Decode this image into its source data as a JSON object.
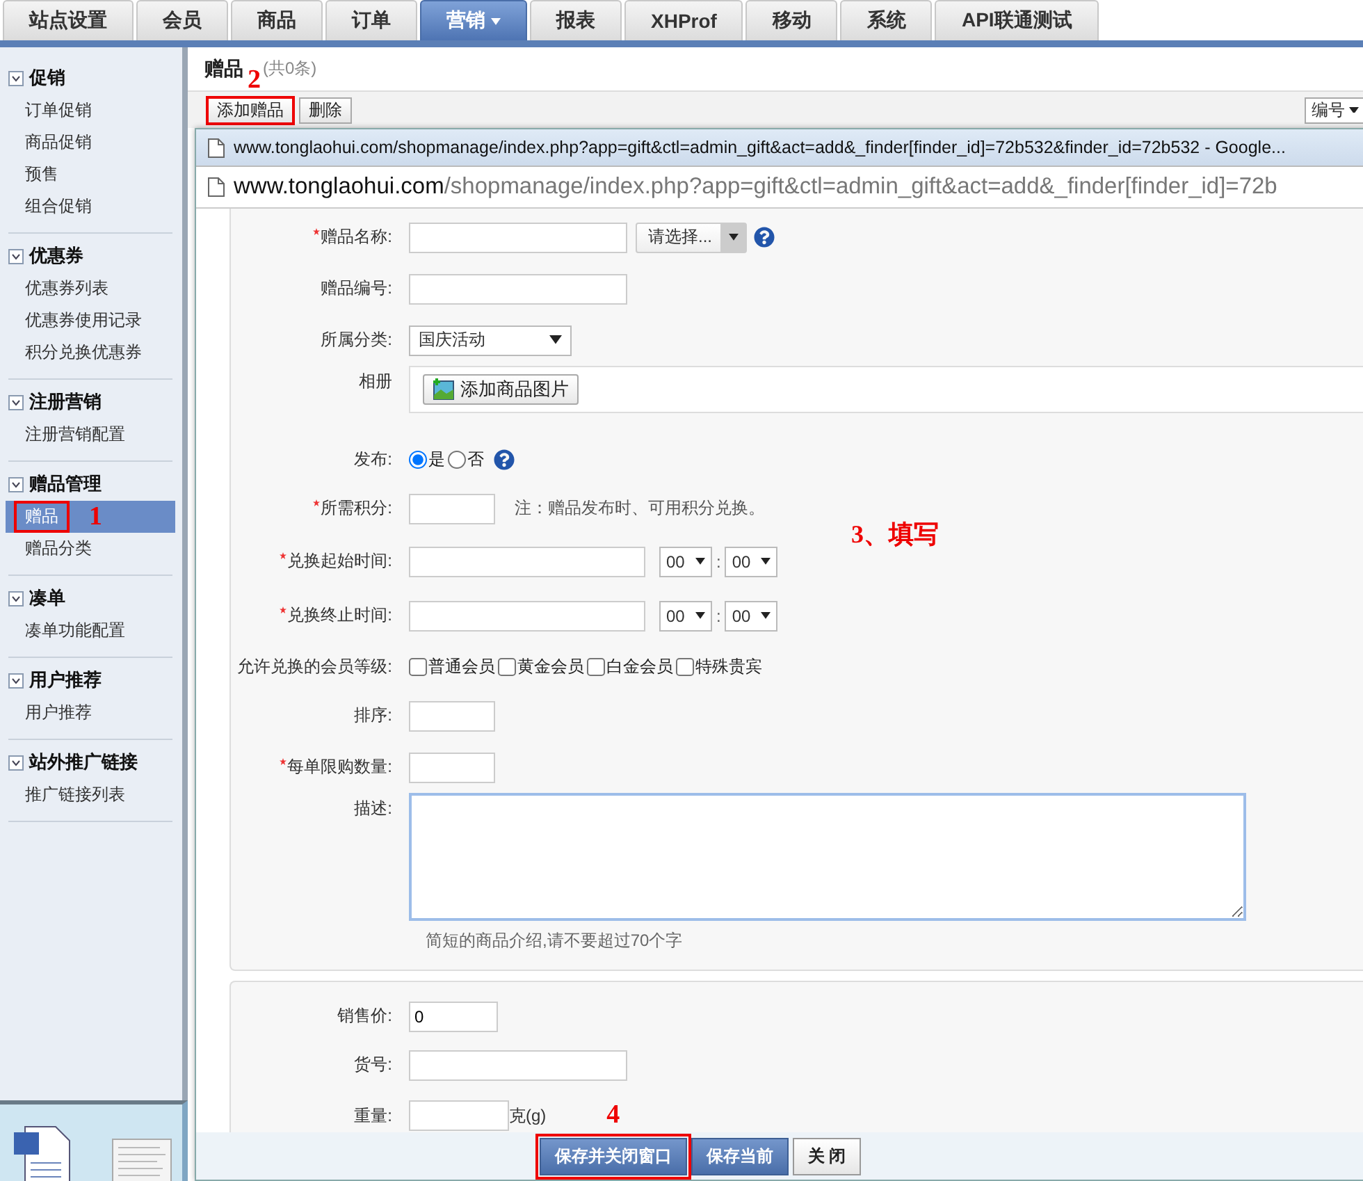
{
  "nav_tabs": [
    {
      "label": "站点设置",
      "selected": false,
      "has_menu": false
    },
    {
      "label": "会员",
      "selected": false,
      "has_menu": false
    },
    {
      "label": "商品",
      "selected": false,
      "has_menu": false
    },
    {
      "label": "订单",
      "selected": false,
      "has_menu": false
    },
    {
      "label": "营销",
      "selected": true,
      "has_menu": true
    },
    {
      "label": "报表",
      "selected": false,
      "has_menu": false
    },
    {
      "label": "XHProf",
      "selected": false,
      "has_menu": false
    },
    {
      "label": "移动",
      "selected": false,
      "has_menu": false
    },
    {
      "label": "系统",
      "selected": false,
      "has_menu": false
    },
    {
      "label": "API联通测试",
      "selected": false,
      "has_menu": false
    }
  ],
  "sidebar": {
    "groups": [
      {
        "title": "促销",
        "expanded": true,
        "items": [
          {
            "label": "订单促销",
            "selected": false
          },
          {
            "label": "商品促销",
            "selected": false
          },
          {
            "label": "预售",
            "selected": false
          },
          {
            "label": "组合促销",
            "selected": false
          }
        ]
      },
      {
        "title": "优惠券",
        "expanded": true,
        "items": [
          {
            "label": "优惠券列表",
            "selected": false
          },
          {
            "label": "优惠券使用记录",
            "selected": false
          },
          {
            "label": "积分兑换优惠券",
            "selected": false
          }
        ]
      },
      {
        "title": "注册营销",
        "expanded": true,
        "items": [
          {
            "label": "注册营销配置",
            "selected": false
          }
        ]
      },
      {
        "title": "赠品管理",
        "expanded": true,
        "items": [
          {
            "label": "赠品",
            "selected": true,
            "marker": "1"
          },
          {
            "label": "赠品分类",
            "selected": false
          }
        ]
      },
      {
        "title": "凑单",
        "expanded": true,
        "items": [
          {
            "label": "凑单功能配置",
            "selected": false
          }
        ]
      },
      {
        "title": "用户推荐",
        "expanded": true,
        "items": [
          {
            "label": "用户推荐",
            "selected": false
          }
        ]
      },
      {
        "title": "站外推广链接",
        "expanded": true,
        "items": [
          {
            "label": "推广链接列表",
            "selected": false
          }
        ]
      }
    ]
  },
  "page": {
    "title": "赠品",
    "count": "(共0条)"
  },
  "toolbar": {
    "buttons": [
      {
        "label": "添加赠品",
        "marker": "2"
      },
      {
        "label": "删除"
      }
    ],
    "sort_select": "编号"
  },
  "popup": {
    "title": "www.tonglaohui.com/shopmanage/index.php?app=gift&ctl=admin_gift&act=add&_finder[finder_id]=72b532&finder_id=72b532 - Google...",
    "address_domain": "www.tonglaohui.com",
    "address_path": "/shopmanage/index.php?app=gift&ctl=admin_gift&act=add&_finder[finder_id]=72b"
  },
  "form": {
    "note": "3、填写",
    "rows": [
      {
        "kind": "combo",
        "label": "赠品名称:",
        "required": true,
        "select": "请选择..."
      },
      {
        "kind": "long_text",
        "label": "赠品编号:",
        "required": false
      },
      {
        "kind": "select",
        "label": "所属分类:",
        "required": false,
        "value": "国庆活动"
      },
      {
        "kind": "album",
        "label": "相册",
        "button": "添加商品图片"
      },
      {
        "kind": "radio",
        "label": "发布:",
        "required": false,
        "options": [
          {
            "label": "是",
            "selected": true
          },
          {
            "label": "否",
            "selected": false
          }
        ]
      },
      {
        "kind": "points",
        "label": "所需积分:",
        "required": true,
        "note": "注：赠品发布时、可用积分兑换。"
      },
      {
        "kind": "datetime",
        "label": "兑换起始时间:",
        "required": true,
        "hour": "00",
        "separator": ":",
        "minute": "00"
      },
      {
        "kind": "datetime",
        "label": "兑换终止时间:",
        "required": true,
        "hour": "00",
        "separator": ":",
        "minute": "00"
      },
      {
        "kind": "checkboxes",
        "label": "允许兑换的会员等级:",
        "required": false,
        "options": [
          {
            "label": "普通会员",
            "checked": false
          },
          {
            "label": "黄金会员",
            "checked": false
          },
          {
            "label": "白金会员",
            "checked": false
          },
          {
            "label": "特殊贵宾",
            "checked": false
          }
        ]
      },
      {
        "kind": "short_text",
        "label": "排序:",
        "required": false
      },
      {
        "kind": "short_text",
        "label": "每单限购数量:",
        "required": true
      },
      {
        "kind": "textarea",
        "label": "描述:",
        "required": false,
        "hint": "简短的商品介绍,请不要超过70个字"
      }
    ]
  },
  "form_extra": {
    "rows": [
      {
        "kind": "price_text",
        "label": "销售价:",
        "required": false,
        "value": "0"
      },
      {
        "kind": "long_text",
        "label": "货号:",
        "required": false
      },
      {
        "kind": "unit",
        "label": "重量:",
        "required": false,
        "unit": "克(g)"
      }
    ]
  },
  "footer_buttons": [
    {
      "label": "保存并关闭窗口",
      "kind": "primary",
      "marker": "4"
    },
    {
      "label": "保存当前",
      "kind": "primary"
    },
    {
      "label": "关 闭",
      "kind": "plain"
    }
  ]
}
